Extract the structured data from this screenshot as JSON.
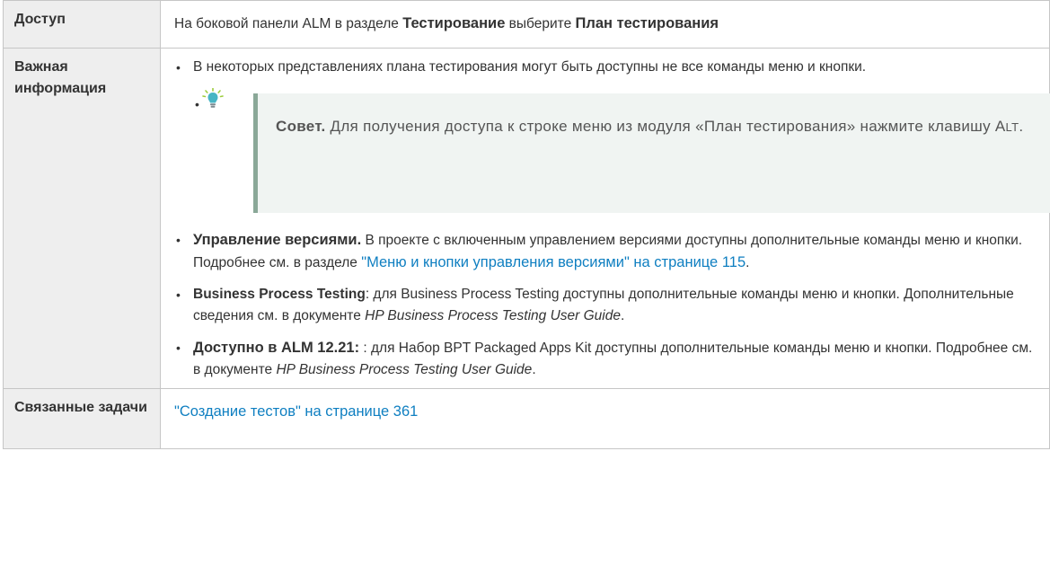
{
  "rows": {
    "access": {
      "label": "Доступ",
      "text_before": "На боковой панели ALM в разделе ",
      "bold1": "Тестирование",
      "text_middle": " выберите ",
      "bold2": "План тестирования"
    },
    "important": {
      "label": "Важная информация",
      "item1": "В некоторых представлениях плана тестирования могут быть доступны не все команды меню и кнопки.",
      "tip": {
        "icon": "lightbulb-icon",
        "head": "Совет.",
        "text": " Для получения доступа к строке меню из модуля «План тестирования» нажмите клавишу A",
        "key_small": "LT",
        "end": "."
      },
      "item2": {
        "bold": "Управление версиями.",
        "text": " В проекте с включенным управлением версиями доступны дополнительные команды меню и кнопки. Подробнее см. в разделе ",
        "link": "\"Меню и кнопки управления версиями\" на странице 115",
        "end": "."
      },
      "item3": {
        "bold": "Business Process Testing",
        "text": ": для Business Process Testing доступны дополнительные команды меню и кнопки. Дополнительные сведения см. в документе ",
        "italic": "HP Business Process Testing User Guide",
        "end": "."
      },
      "item4": {
        "bold": "Доступно в ALM 12.21:",
        "text": " : для Набор BPT Packaged Apps Kit доступны дополнительные команды меню и кнопки. Подробнее см. в документе ",
        "italic": "HP Business Process Testing User Guide",
        "end": "."
      }
    },
    "tasks": {
      "label": "Связанные задачи",
      "link": "\"Создание тестов\" на странице 361"
    }
  },
  "colors": {
    "link": "#0f7fc1",
    "label_bg": "#eeeeee",
    "tip_bg": "#f0f4f2",
    "tip_border": "#8aa898"
  }
}
